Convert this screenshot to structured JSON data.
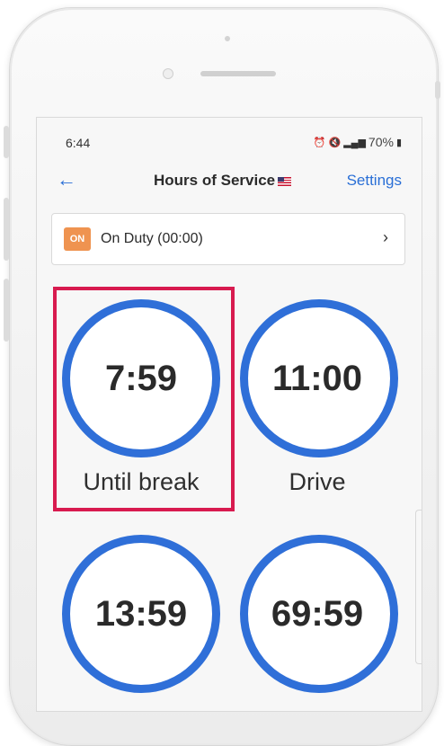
{
  "status_bar": {
    "time": "6:44",
    "battery": "70%"
  },
  "app_bar": {
    "title": "Hours of Service",
    "settings_label": "Settings"
  },
  "duty": {
    "badge": "ON",
    "text": "On Duty (00:00)"
  },
  "timers": [
    {
      "value": "7:59",
      "label": "Until break"
    },
    {
      "value": "11:00",
      "label": "Drive"
    },
    {
      "value": "13:59",
      "label": ""
    },
    {
      "value": "69:59",
      "label": ""
    }
  ],
  "colors": {
    "accent": "#2f6fd8",
    "duty_badge": "#ef9350",
    "highlight": "#d81b4f"
  }
}
